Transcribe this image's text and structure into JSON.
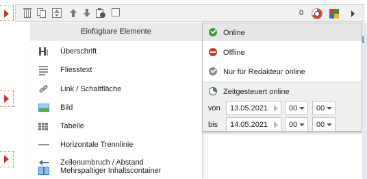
{
  "toolbar": {
    "count": "0",
    "icons": [
      "trash-icon",
      "copy-icon",
      "move-icon",
      "arrow-up-icon",
      "arrow-down-icon",
      "paste-icon",
      "checkbox-icon",
      "schedule-clock-icon",
      "color-grid-icon",
      "more-arrow-icon"
    ]
  },
  "insert_panel": {
    "title": "Einfügbare Elemente",
    "items": [
      {
        "label": "Überschrift",
        "icon": "heading-icon"
      },
      {
        "label": "Fliesstext",
        "icon": "text-paragraph-icon"
      },
      {
        "label": "Link / Schaltfläche",
        "icon": "link-icon"
      },
      {
        "label": "Bild",
        "icon": "image-icon"
      },
      {
        "label": "Tabelle",
        "icon": "table-icon"
      },
      {
        "label": "Horizontale Trennlinie",
        "icon": "horizontal-rule-icon"
      },
      {
        "label": "Zeilenumbruch / Abstand",
        "icon": "line-break-icon"
      },
      {
        "label": "Mehrspaltiger Inhaltscontainer",
        "icon": "columns-icon"
      }
    ]
  },
  "status_menu": {
    "items": [
      {
        "label": "Online",
        "icon": "online-check-icon",
        "color": "#2e9b38"
      },
      {
        "label": "Offline",
        "icon": "offline-minus-icon",
        "color": "#d73226"
      },
      {
        "label": "Nur für Redakteur online",
        "icon": "editor-check-icon",
        "color": "#8a8a8a"
      },
      {
        "label": "Zeitgesteuert online",
        "icon": "scheduled-clock-icon",
        "color": "#3a9a3a"
      }
    ],
    "schedule": {
      "from": {
        "label": "von",
        "date": "13.05.2021",
        "hour": "00",
        "minute": "00"
      },
      "to": {
        "label": "bis",
        "date": "14.05.2021",
        "hour": "00",
        "minute": "00"
      }
    }
  }
}
